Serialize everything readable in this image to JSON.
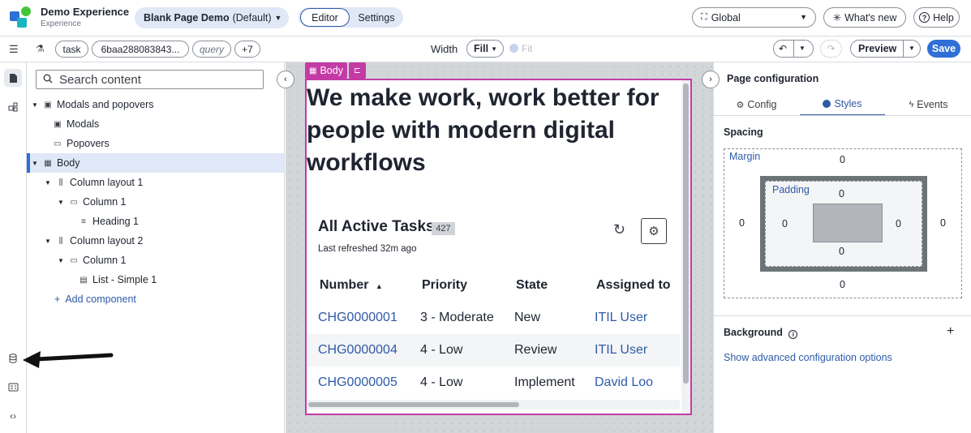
{
  "app": {
    "title": "Demo Experience",
    "subtitle": "Experience"
  },
  "page_selector": {
    "name": "Blank Page Demo",
    "default_label": "(Default)"
  },
  "mode_toggle": {
    "editor": "Editor",
    "settings": "Settings"
  },
  "header_right": {
    "scope": "Global",
    "whats_new": "What's new",
    "help": "Help"
  },
  "toolbar": {
    "chips": [
      "task",
      "6baa288083843...",
      "query",
      "+7"
    ],
    "width_label": "Width",
    "width_value": "Fill",
    "fit_label": "Fit",
    "preview": "Preview",
    "save": "Save"
  },
  "outline": {
    "search_placeholder": "Search content",
    "items": [
      {
        "label": "Modals and popovers",
        "icon": "modal-group-icon"
      },
      {
        "label": "Modals",
        "icon": "modal-icon"
      },
      {
        "label": "Popovers",
        "icon": "popover-icon"
      },
      {
        "label": "Body",
        "icon": "body-icon",
        "selected": true
      },
      {
        "label": "Column layout 1",
        "icon": "column-layout-icon"
      },
      {
        "label": "Column 1",
        "icon": "column-icon"
      },
      {
        "label": "Heading 1",
        "icon": "heading-icon"
      },
      {
        "label": "Column layout 2",
        "icon": "column-layout-icon"
      },
      {
        "label": "Column 1",
        "icon": "column-icon"
      },
      {
        "label": "List - Simple 1",
        "icon": "list-icon"
      }
    ],
    "add_component": "Add component"
  },
  "canvas": {
    "tag": "Body",
    "heading": "We make work, work better for people with modern digital workflows",
    "list": {
      "title": "All Active Tasks",
      "count": "427",
      "last_refreshed": "Last refreshed 32m ago",
      "columns": [
        "Number",
        "Priority",
        "State",
        "Assigned to"
      ],
      "rows": [
        [
          "CHG0000001",
          "3 - Moderate",
          "New",
          "ITIL User"
        ],
        [
          "CHG0000004",
          "4 - Low",
          "Review",
          "ITIL User"
        ],
        [
          "CHG0000005",
          "4 - Low",
          "Implement",
          "David Loo"
        ]
      ]
    }
  },
  "config": {
    "title": "Page configuration",
    "tabs": [
      "Config",
      "Styles",
      "Events"
    ],
    "active_tab": "Styles",
    "spacing_title": "Spacing",
    "margin_label": "Margin",
    "padding_label": "Padding",
    "margin": {
      "top": "0",
      "right": "0",
      "bottom": "0",
      "left": "0"
    },
    "padding": {
      "top": "0",
      "right": "0",
      "bottom": "0",
      "left": "0"
    },
    "background_title": "Background",
    "advanced_link": "Show advanced configuration options"
  },
  "colors": {
    "accent": "#2f6fd6",
    "selection": "#c43ba6",
    "link": "#2f5aa8"
  }
}
